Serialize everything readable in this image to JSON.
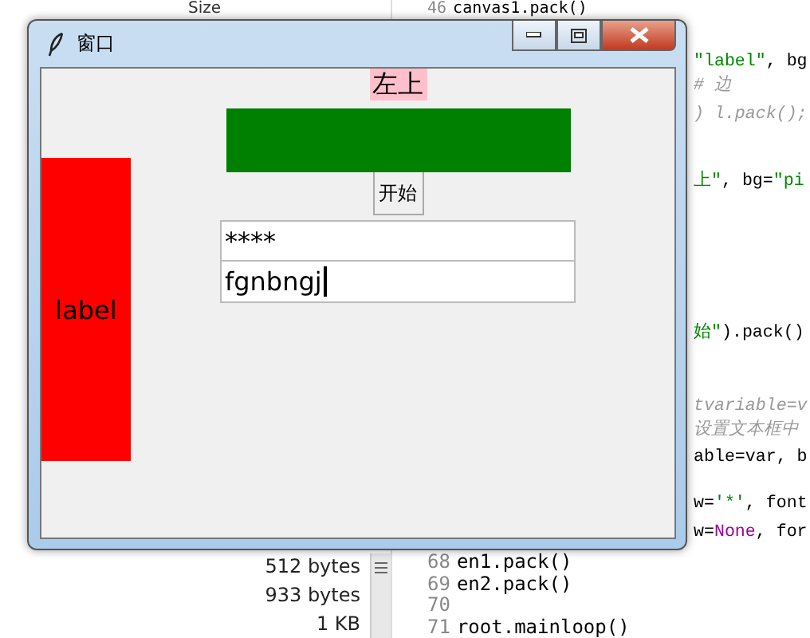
{
  "file_list": {
    "header": "Size",
    "sizes": [
      "512 bytes",
      "933 bytes",
      "1 KB"
    ]
  },
  "editor": {
    "top_line": {
      "number": "46",
      "segments": [
        {
          "kind": "code",
          "text": "canvas1.pack()"
        }
      ]
    },
    "right_fragments": [
      {
        "segments": [
          {
            "kind": "string",
            "text": "\"label\""
          },
          {
            "kind": "code",
            "text": ", bg"
          }
        ]
      },
      {
        "segments": [
          {
            "kind": "comment",
            "text": "# 边"
          }
        ]
      },
      {
        "segments": [
          {
            "kind": "comment",
            "text": ") l.pack();"
          }
        ]
      },
      {
        "segments": [
          {
            "kind": "string",
            "text": "上\""
          },
          {
            "kind": "code",
            "text": ", bg="
          },
          {
            "kind": "string",
            "text": "\"pi"
          }
        ]
      },
      {
        "segments": [
          {
            "kind": "string",
            "text": "始\""
          },
          {
            "kind": "code",
            "text": ").pack()"
          }
        ]
      },
      {
        "segments": [
          {
            "kind": "comment",
            "text": "tvariable=v"
          }
        ]
      },
      {
        "segments": [
          {
            "kind": "comment",
            "text": "设置文本框中"
          }
        ]
      },
      {
        "segments": [
          {
            "kind": "code",
            "text": "able=var, b"
          }
        ]
      },
      {
        "segments": [
          {
            "kind": "code",
            "text": "w="
          },
          {
            "kind": "string",
            "text": "'*'"
          },
          {
            "kind": "code",
            "text": ", font"
          }
        ]
      },
      {
        "segments": [
          {
            "kind": "code",
            "text": "w="
          },
          {
            "kind": "keyword",
            "text": "None"
          },
          {
            "kind": "code",
            "text": ", for"
          }
        ]
      }
    ],
    "bottom_lines": [
      {
        "number": "68",
        "segments": [
          {
            "kind": "code",
            "text": "en1.pack()"
          }
        ]
      },
      {
        "number": "69",
        "segments": [
          {
            "kind": "code",
            "text": "en2.pack()"
          }
        ]
      },
      {
        "number": "70"
      },
      {
        "number": "71",
        "segments": [
          {
            "kind": "code",
            "text": "root.mainloop()"
          }
        ]
      }
    ]
  },
  "window": {
    "title": "窗口",
    "top_label": {
      "text": "左上",
      "color": "#ffc0cb"
    },
    "canvas": {
      "color": "#008000"
    },
    "button": "开始",
    "password_entry": {
      "value": "****"
    },
    "text_entry": {
      "value": "fgnbngj",
      "focused": true
    },
    "side_label": {
      "text": "label",
      "color": "#ff0000"
    }
  }
}
